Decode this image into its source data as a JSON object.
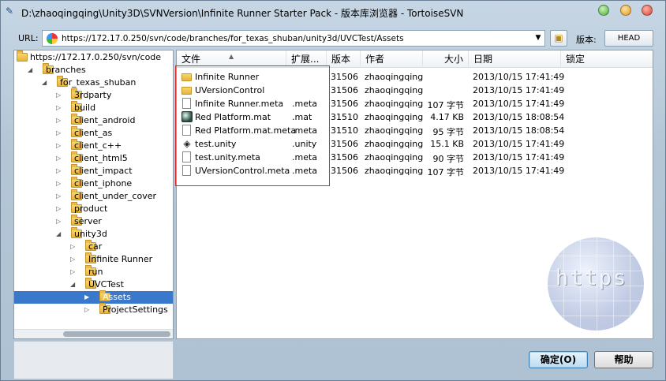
{
  "window": {
    "title": "D:\\zhaoqingqing\\Unity3D\\SVNVersion\\Infinite Runner Starter Pack - 版本库浏览器 - TortoiseSVN"
  },
  "urlbar": {
    "label": "URL:",
    "value": "https://172.17.0.250/svn/code/branches/for_texas_shuban/unity3d/UVCTest/Assets",
    "revision_label": "版本:",
    "revision_button": "HEAD"
  },
  "tree": [
    {
      "label": "https://172.17.0.250/svn/code",
      "depth": 0,
      "arrow": ""
    },
    {
      "label": "branches",
      "depth": 1,
      "arrow": "◢"
    },
    {
      "label": "for_texas_shuban",
      "depth": 2,
      "arrow": "◢"
    },
    {
      "label": "3rdparty",
      "depth": 3,
      "arrow": "▷"
    },
    {
      "label": "build",
      "depth": 3,
      "arrow": "▷"
    },
    {
      "label": "client_android",
      "depth": 3,
      "arrow": "▷"
    },
    {
      "label": "client_as",
      "depth": 3,
      "arrow": "▷"
    },
    {
      "label": "client_c++",
      "depth": 3,
      "arrow": "▷"
    },
    {
      "label": "client_html5",
      "depth": 3,
      "arrow": "▷"
    },
    {
      "label": "client_impact",
      "depth": 3,
      "arrow": "▷"
    },
    {
      "label": "client_iphone",
      "depth": 3,
      "arrow": "▷"
    },
    {
      "label": "client_under_cover",
      "depth": 3,
      "arrow": "▷"
    },
    {
      "label": "product",
      "depth": 3,
      "arrow": "▷"
    },
    {
      "label": "server",
      "depth": 3,
      "arrow": "▷"
    },
    {
      "label": "unity3d",
      "depth": 3,
      "arrow": "◢"
    },
    {
      "label": "car",
      "depth": 4,
      "arrow": "▷"
    },
    {
      "label": "Infinite Runner",
      "depth": 4,
      "arrow": "▷"
    },
    {
      "label": "run",
      "depth": 4,
      "arrow": "▷"
    },
    {
      "label": "UVCTest",
      "depth": 4,
      "arrow": "◢"
    },
    {
      "label": "Assets",
      "depth": 5,
      "arrow": "▶",
      "selected": true
    },
    {
      "label": "ProjectSettings",
      "depth": 5,
      "arrow": "▷"
    }
  ],
  "columns": {
    "file": "文件",
    "ext": "扩展...",
    "rev": "版本",
    "author": "作者",
    "size": "大小",
    "date": "日期",
    "lock": "锁定"
  },
  "files": [
    {
      "icon": "folder-icon",
      "name": "Infinite Runner",
      "ext": "",
      "rev": "31506",
      "author": "zhaoqingqing",
      "size": "",
      "date": "2013/10/15 17:41:49"
    },
    {
      "icon": "folder-icon",
      "name": "UVersionControl",
      "ext": "",
      "rev": "31506",
      "author": "zhaoqingqing",
      "size": "",
      "date": "2013/10/15 17:41:49"
    },
    {
      "icon": "document-icon",
      "name": "Infinite Runner.meta",
      "ext": ".meta",
      "rev": "31506",
      "author": "zhaoqingqing",
      "size": "107 字节",
      "date": "2013/10/15 17:41:49"
    },
    {
      "icon": "material-icon",
      "name": "Red Platform.mat",
      "ext": ".mat",
      "rev": "31510",
      "author": "zhaoqingqing",
      "size": "4.17 KB",
      "date": "2013/10/15 18:08:54"
    },
    {
      "icon": "document-icon",
      "name": "Red Platform.mat.meta",
      "ext": ".meta",
      "rev": "31510",
      "author": "zhaoqingqing",
      "size": "95 字节",
      "date": "2013/10/15 18:08:54"
    },
    {
      "icon": "unity-icon",
      "name": "test.unity",
      "ext": ".unity",
      "rev": "31506",
      "author": "zhaoqingqing",
      "size": "15.1 KB",
      "date": "2013/10/15 17:41:49"
    },
    {
      "icon": "document-icon",
      "name": "test.unity.meta",
      "ext": ".meta",
      "rev": "31506",
      "author": "zhaoqingqing",
      "size": "90 字节",
      "date": "2013/10/15 17:41:49"
    },
    {
      "icon": "document-icon",
      "name": "UVersionControl.meta",
      "ext": ".meta",
      "rev": "31506",
      "author": "zhaoqingqing",
      "size": "107 字节",
      "date": "2013/10/15 17:41:49"
    }
  ],
  "watermark": {
    "text": "https"
  },
  "buttons": {
    "ok": "确定(O)",
    "help": "帮助"
  }
}
